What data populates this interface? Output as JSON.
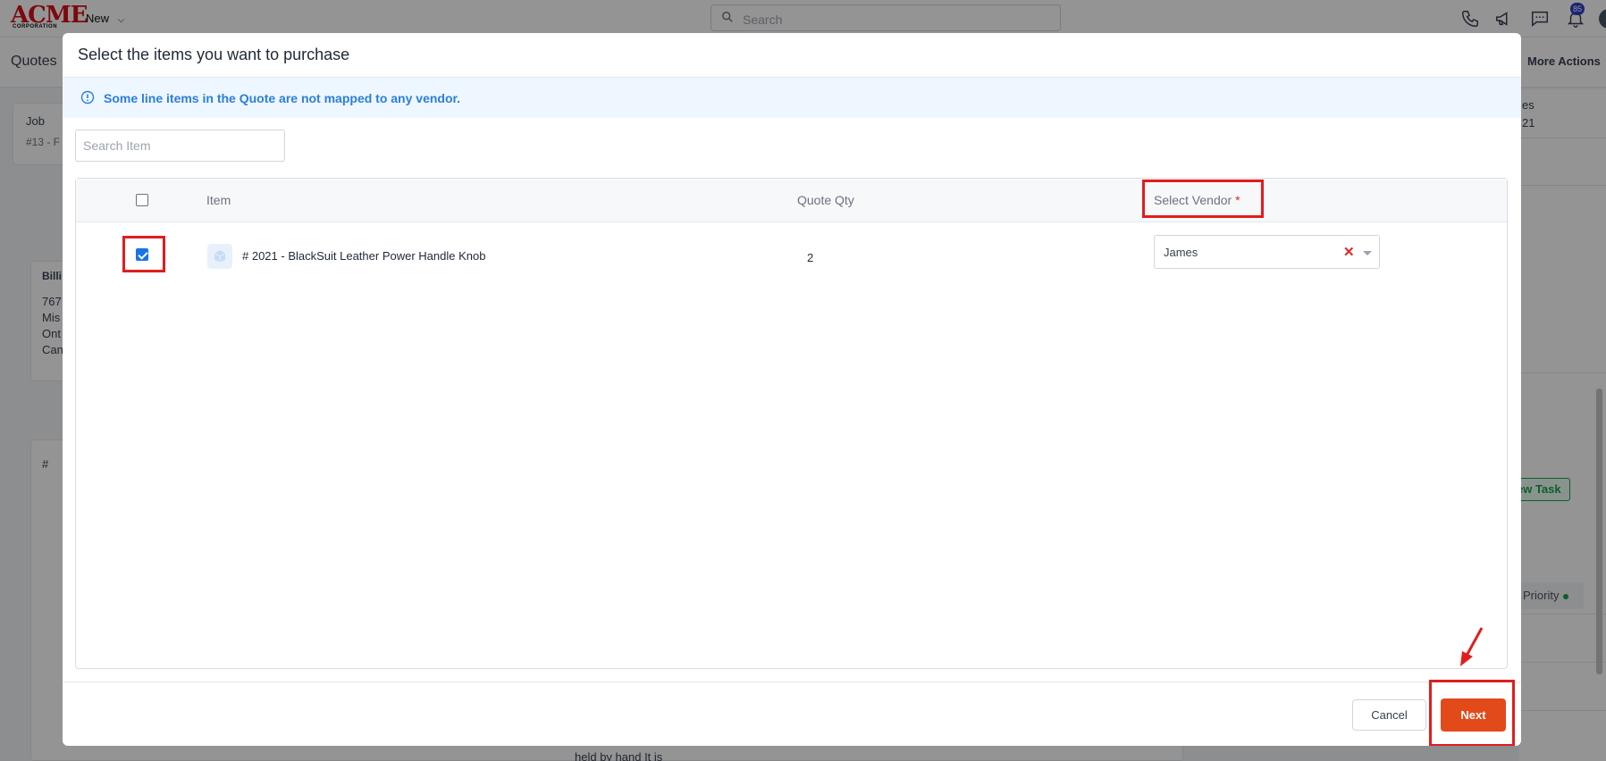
{
  "app": {
    "logo": "ACME",
    "logo_sub": "CORPORATION",
    "new_menu": "New",
    "search_placeholder": "Search",
    "notification_count": "85",
    "page_title": "Quotes",
    "more_actions": "More Actions",
    "new_task": "ew Task",
    "priority": "Priority"
  },
  "background": {
    "job_label": "Job",
    "job_value": "#13 - F",
    "billing_label": "Billi",
    "address_lines": [
      "767",
      "Mis",
      "Ont",
      "Can"
    ],
    "hash_col": "#",
    "desc_snippet": "held by hand It is",
    "right_snippets": [
      "es",
      "21"
    ]
  },
  "modal": {
    "title": "Select the items you want to purchase",
    "alert": "Some line items in the Quote are not mapped to any vendor.",
    "search_placeholder": "Search Item",
    "columns": {
      "item": "Item",
      "quote_qty": "Quote Qty",
      "select_vendor": "Select Vendor",
      "required_marker": "*"
    },
    "rows": [
      {
        "checked": true,
        "item": "# 2021 - BlackSuit Leather Power Handle Knob",
        "quote_qty": "2",
        "vendor": "James"
      }
    ],
    "cancel_label": "Cancel",
    "next_label": "Next"
  },
  "colors": {
    "primary_button": "#e24a1a",
    "alert_text": "#2b7fd9",
    "alert_bg": "#eef6ff",
    "highlight": "#e11d1d",
    "checkbox": "#1a73e8"
  },
  "icons": {
    "search": "search-icon",
    "info": "info-icon",
    "phone": "phone-icon",
    "megaphone": "megaphone-icon",
    "chat": "chat-icon",
    "bell": "bell-icon"
  }
}
